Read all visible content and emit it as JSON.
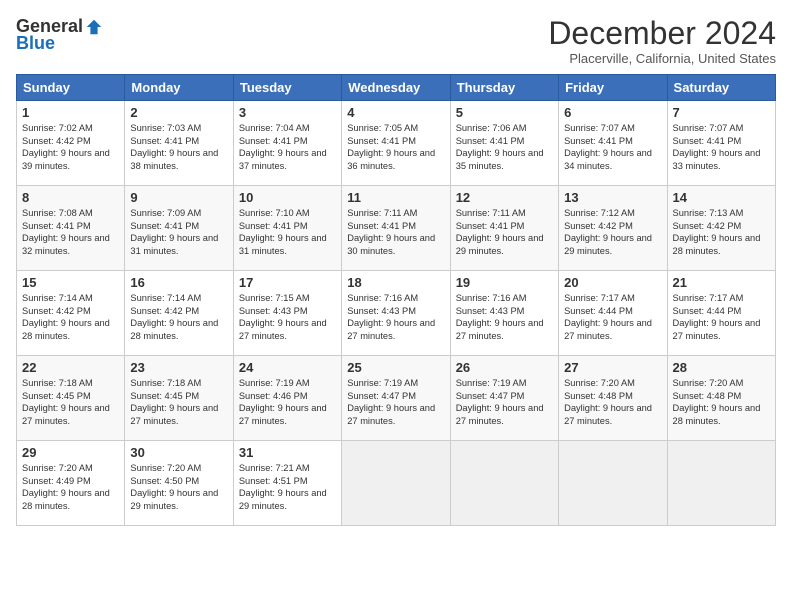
{
  "logo": {
    "general": "General",
    "blue": "Blue"
  },
  "title": "December 2024",
  "location": "Placerville, California, United States",
  "days_header": [
    "Sunday",
    "Monday",
    "Tuesday",
    "Wednesday",
    "Thursday",
    "Friday",
    "Saturday"
  ],
  "weeks": [
    [
      {
        "day": "1",
        "sunrise": "7:02 AM",
        "sunset": "4:42 PM",
        "daylight": "9 hours and 39 minutes."
      },
      {
        "day": "2",
        "sunrise": "7:03 AM",
        "sunset": "4:41 PM",
        "daylight": "9 hours and 38 minutes."
      },
      {
        "day": "3",
        "sunrise": "7:04 AM",
        "sunset": "4:41 PM",
        "daylight": "9 hours and 37 minutes."
      },
      {
        "day": "4",
        "sunrise": "7:05 AM",
        "sunset": "4:41 PM",
        "daylight": "9 hours and 36 minutes."
      },
      {
        "day": "5",
        "sunrise": "7:06 AM",
        "sunset": "4:41 PM",
        "daylight": "9 hours and 35 minutes."
      },
      {
        "day": "6",
        "sunrise": "7:07 AM",
        "sunset": "4:41 PM",
        "daylight": "9 hours and 34 minutes."
      },
      {
        "day": "7",
        "sunrise": "7:07 AM",
        "sunset": "4:41 PM",
        "daylight": "9 hours and 33 minutes."
      }
    ],
    [
      {
        "day": "8",
        "sunrise": "7:08 AM",
        "sunset": "4:41 PM",
        "daylight": "9 hours and 32 minutes."
      },
      {
        "day": "9",
        "sunrise": "7:09 AM",
        "sunset": "4:41 PM",
        "daylight": "9 hours and 31 minutes."
      },
      {
        "day": "10",
        "sunrise": "7:10 AM",
        "sunset": "4:41 PM",
        "daylight": "9 hours and 31 minutes."
      },
      {
        "day": "11",
        "sunrise": "7:11 AM",
        "sunset": "4:41 PM",
        "daylight": "9 hours and 30 minutes."
      },
      {
        "day": "12",
        "sunrise": "7:11 AM",
        "sunset": "4:41 PM",
        "daylight": "9 hours and 29 minutes."
      },
      {
        "day": "13",
        "sunrise": "7:12 AM",
        "sunset": "4:42 PM",
        "daylight": "9 hours and 29 minutes."
      },
      {
        "day": "14",
        "sunrise": "7:13 AM",
        "sunset": "4:42 PM",
        "daylight": "9 hours and 28 minutes."
      }
    ],
    [
      {
        "day": "15",
        "sunrise": "7:14 AM",
        "sunset": "4:42 PM",
        "daylight": "9 hours and 28 minutes."
      },
      {
        "day": "16",
        "sunrise": "7:14 AM",
        "sunset": "4:42 PM",
        "daylight": "9 hours and 28 minutes."
      },
      {
        "day": "17",
        "sunrise": "7:15 AM",
        "sunset": "4:43 PM",
        "daylight": "9 hours and 27 minutes."
      },
      {
        "day": "18",
        "sunrise": "7:16 AM",
        "sunset": "4:43 PM",
        "daylight": "9 hours and 27 minutes."
      },
      {
        "day": "19",
        "sunrise": "7:16 AM",
        "sunset": "4:43 PM",
        "daylight": "9 hours and 27 minutes."
      },
      {
        "day": "20",
        "sunrise": "7:17 AM",
        "sunset": "4:44 PM",
        "daylight": "9 hours and 27 minutes."
      },
      {
        "day": "21",
        "sunrise": "7:17 AM",
        "sunset": "4:44 PM",
        "daylight": "9 hours and 27 minutes."
      }
    ],
    [
      {
        "day": "22",
        "sunrise": "7:18 AM",
        "sunset": "4:45 PM",
        "daylight": "9 hours and 27 minutes."
      },
      {
        "day": "23",
        "sunrise": "7:18 AM",
        "sunset": "4:45 PM",
        "daylight": "9 hours and 27 minutes."
      },
      {
        "day": "24",
        "sunrise": "7:19 AM",
        "sunset": "4:46 PM",
        "daylight": "9 hours and 27 minutes."
      },
      {
        "day": "25",
        "sunrise": "7:19 AM",
        "sunset": "4:47 PM",
        "daylight": "9 hours and 27 minutes."
      },
      {
        "day": "26",
        "sunrise": "7:19 AM",
        "sunset": "4:47 PM",
        "daylight": "9 hours and 27 minutes."
      },
      {
        "day": "27",
        "sunrise": "7:20 AM",
        "sunset": "4:48 PM",
        "daylight": "9 hours and 27 minutes."
      },
      {
        "day": "28",
        "sunrise": "7:20 AM",
        "sunset": "4:48 PM",
        "daylight": "9 hours and 28 minutes."
      }
    ],
    [
      {
        "day": "29",
        "sunrise": "7:20 AM",
        "sunset": "4:49 PM",
        "daylight": "9 hours and 28 minutes."
      },
      {
        "day": "30",
        "sunrise": "7:20 AM",
        "sunset": "4:50 PM",
        "daylight": "9 hours and 29 minutes."
      },
      {
        "day": "31",
        "sunrise": "7:21 AM",
        "sunset": "4:51 PM",
        "daylight": "9 hours and 29 minutes."
      },
      null,
      null,
      null,
      null
    ]
  ]
}
